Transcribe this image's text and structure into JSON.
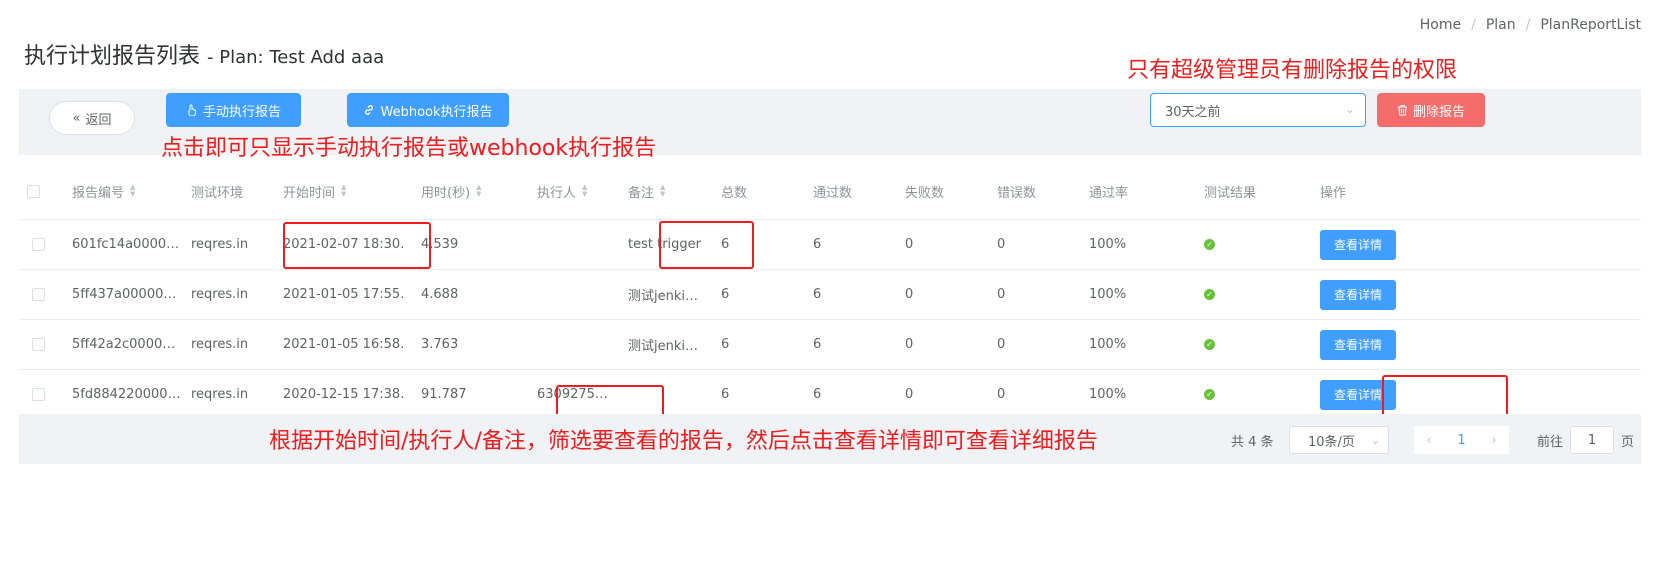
{
  "breadcrumb": [
    "Home",
    "Plan",
    "PlanReportList"
  ],
  "page": {
    "title": "执行计划报告列表",
    "subtitle": "- Plan: Test Add aaa"
  },
  "annotations": {
    "delete_note": "只有超级管理员有删除报告的权限",
    "filter_note": "点击即可只显示手动执行报告或webhook执行报告",
    "bottom_note": "根据开始时间/执行人/备注，筛选要查看的报告，然后点击查看详情即可查看详细报告"
  },
  "toolbar": {
    "back_label": "返回",
    "manual_label": "手动执行报告",
    "webhook_label": "Webhook执行报告",
    "date_filter_value": "30天之前",
    "delete_label": "删除报告"
  },
  "table": {
    "columns": [
      "报告编号",
      "测试环境",
      "开始时间",
      "用时(秒)",
      "执行人",
      "备注",
      "总数",
      "通过数",
      "失败数",
      "错误数",
      "通过率",
      "测试结果",
      "操作"
    ],
    "rows": [
      {
        "id": "601fc14a0000…",
        "env": "reqres.in",
        "start": "2021-02-07 18:30…",
        "duration": "4.539",
        "executor": "",
        "note": "test trigger",
        "total": "6",
        "passed": "6",
        "failed": "0",
        "errors": "0",
        "rate": "100%",
        "action": "查看详情"
      },
      {
        "id": "5ff437a00000…",
        "env": "reqres.in",
        "start": "2021-01-05 17:55…",
        "duration": "4.688",
        "executor": "",
        "note": "测试jenki…",
        "total": "6",
        "passed": "6",
        "failed": "0",
        "errors": "0",
        "rate": "100%",
        "action": "查看详情"
      },
      {
        "id": "5ff42a2c0000…",
        "env": "reqres.in",
        "start": "2021-01-05 16:58…",
        "duration": "3.763",
        "executor": "",
        "note": "测试jenki…",
        "total": "6",
        "passed": "6",
        "failed": "0",
        "errors": "0",
        "rate": "100%",
        "action": "查看详情"
      },
      {
        "id": "5fd884220000…",
        "env": "reqres.in",
        "start": "2020-12-15 17:38…",
        "duration": "91.787",
        "executor": "6309275…",
        "note": "",
        "total": "6",
        "passed": "6",
        "failed": "0",
        "errors": "0",
        "rate": "100%",
        "action": "查看详情"
      }
    ]
  },
  "pagination": {
    "total_text": "共 4 条",
    "page_size": "10条/页",
    "current_page": "1",
    "goto_label": "前往",
    "goto_value": "1",
    "page_unit": "页"
  },
  "colors": {
    "accent": "#409eff",
    "danger": "#f56c6c",
    "success": "#67c23a",
    "annotation": "#ee1c1c"
  }
}
